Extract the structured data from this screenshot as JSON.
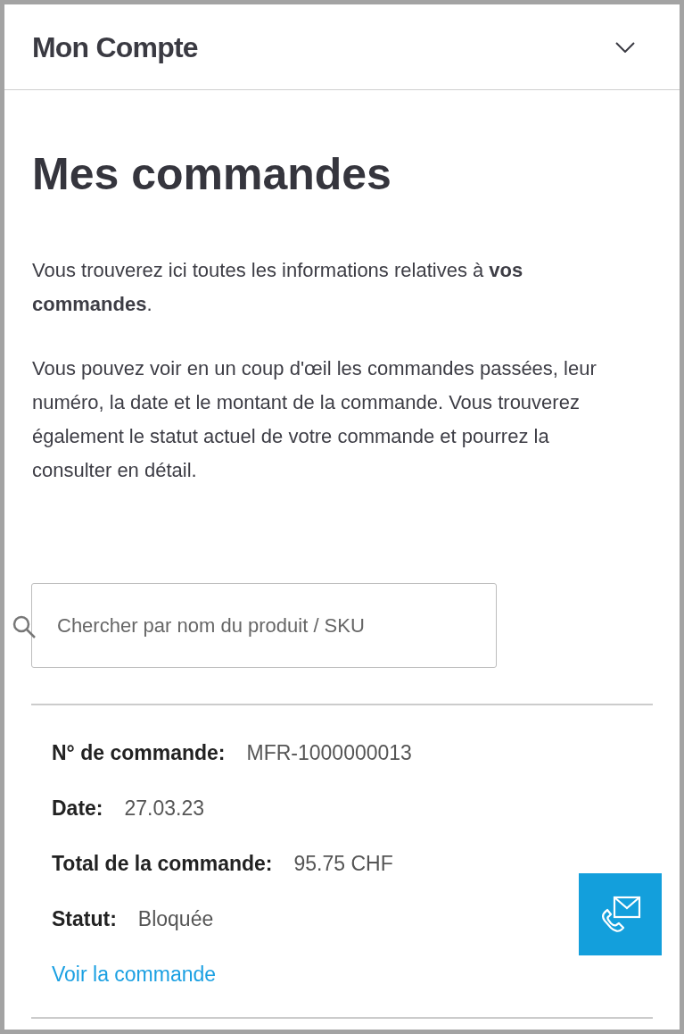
{
  "account_menu": {
    "title": "Mon Compte",
    "expanded": false
  },
  "page_title": "Mes commandes",
  "intro": [
    "Vous trouverez ici toutes les informations relatives à **vos commandes**.",
    "Vous pouvez voir en un coup d'œil les commandes passées, leur numéro, la date et le montant de la commande. Vous trouverez également le statut actuel de votre commande et pourrez la consulter en détail."
  ],
  "search": {
    "placeholder": "Chercher par nom du produit / SKU"
  },
  "orders": [
    {
      "fields": [
        {
          "label": "N° de commande:",
          "value": "MFR-1000000013"
        },
        {
          "label": "Date:",
          "value": "27.03.23"
        },
        {
          "label": "Total de la commande:",
          "value": "95.75 CHF"
        },
        {
          "label": "Statut:",
          "value": "Bloquée"
        }
      ],
      "link": "Voir la commande"
    }
  ]
}
